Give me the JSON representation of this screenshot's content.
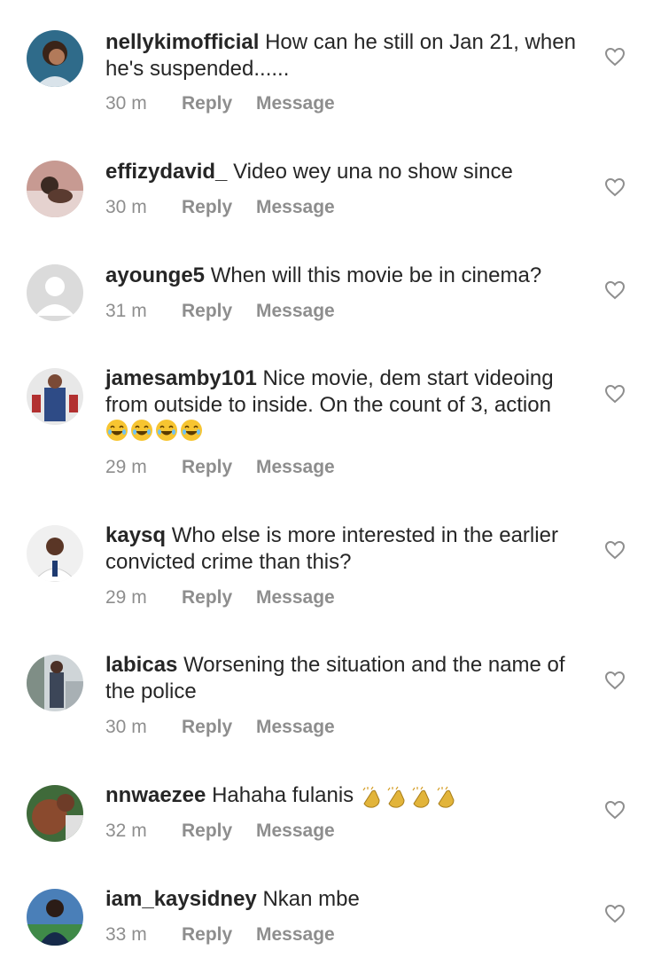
{
  "comments": [
    {
      "username": "nellykimofficial",
      "text": "How can he still on Jan 21, when he's  suspended......",
      "time": "30 m",
      "reply": "Reply",
      "message": "Message"
    },
    {
      "username": "effizydavid_",
      "text": "Video wey una no show since",
      "time": "30 m",
      "reply": "Reply",
      "message": "Message"
    },
    {
      "username": "ayounge5",
      "text": "When will this movie be in cinema?",
      "time": "31 m",
      "reply": "Reply",
      "message": "Message"
    },
    {
      "username": "jamesamby101",
      "text": "Nice movie, dem start videoing from outside to inside. On the count of 3, action",
      "emoji_line": "😂😂😂😂",
      "time": "29 m",
      "reply": "Reply",
      "message": "Message"
    },
    {
      "username": "kaysq",
      "text": "Who else is more interested in the earlier convicted crime than this?",
      "time": "29 m",
      "reply": "Reply",
      "message": "Message"
    },
    {
      "username": "labicas",
      "text": "Worsening the situation and the name of the police",
      "time": "30 m",
      "reply": "Reply",
      "message": "Message"
    },
    {
      "username": "nnwaezee",
      "text": "Hahaha fulanis",
      "time": "32 m",
      "reply": "Reply",
      "message": "Message"
    },
    {
      "username": "iam_kaysidney",
      "text": "Nkan mbe",
      "time": "33 m",
      "reply": "Reply",
      "message": "Message"
    }
  ],
  "icons": {
    "like": "heart-outline-icon",
    "clap": "clapping-hands-emoji",
    "laugh": "laughing-emoji"
  },
  "colors": {
    "text": "#262626",
    "secondary": "#8e8e8e",
    "background": "#ffffff"
  }
}
